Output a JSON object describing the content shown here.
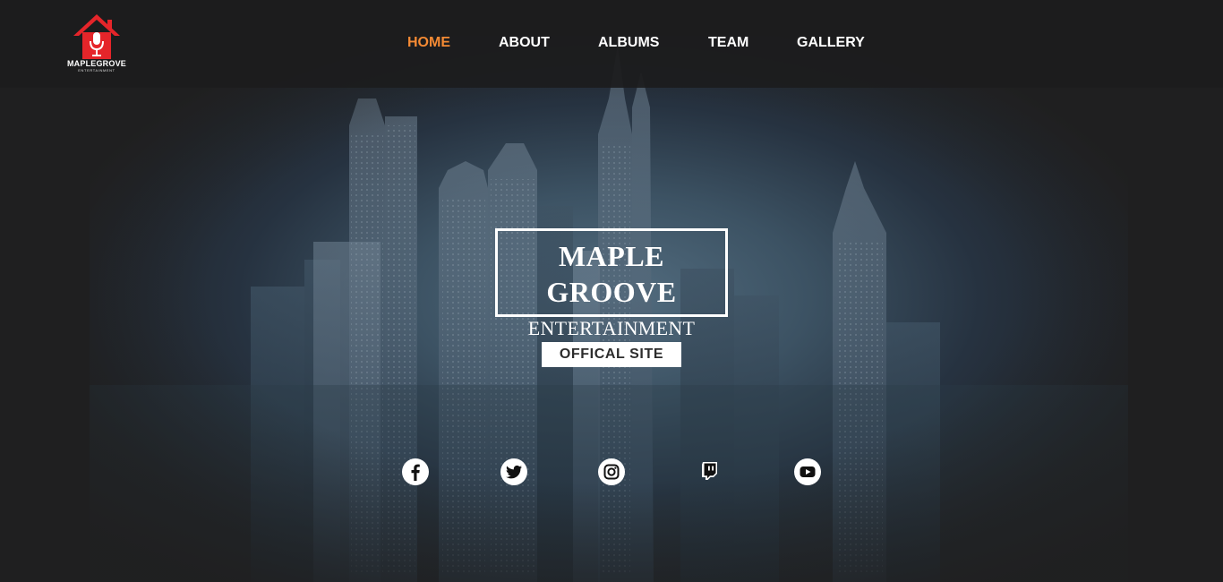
{
  "brand": {
    "name": "MAPLEGROVE",
    "tagline": "ENTERTAINMENT",
    "logo_icon": "house-microphone-icon",
    "logo_color": "#e5252a"
  },
  "nav": {
    "items": [
      {
        "label": "HOME",
        "active": true
      },
      {
        "label": "ABOUT",
        "active": false
      },
      {
        "label": "ALBUMS",
        "active": false
      },
      {
        "label": "TEAM",
        "active": false
      },
      {
        "label": "GALLERY",
        "active": false
      }
    ],
    "active_color": "#f48a34"
  },
  "hero": {
    "title_line1": "MAPLE",
    "title_line2": "GROOVE",
    "subtitle": "ENTERTAINMENT",
    "button_label": "OFFICAL SITE"
  },
  "social": [
    {
      "icon": "facebook-icon"
    },
    {
      "icon": "twitter-icon"
    },
    {
      "icon": "instagram-icon"
    },
    {
      "icon": "twitch-icon"
    },
    {
      "icon": "youtube-icon"
    }
  ]
}
